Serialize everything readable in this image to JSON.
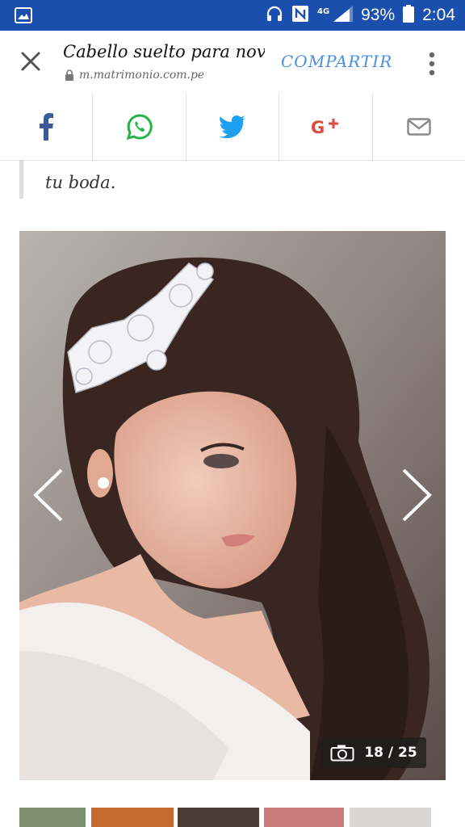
{
  "statusbar": {
    "battery": "93%",
    "time": "2:04",
    "icons": [
      "image-icon",
      "headphones-icon",
      "nfc-icon",
      "signal-4g-icon",
      "battery-icon"
    ]
  },
  "toolbar": {
    "title": "Cabello suelto para novi...",
    "url": "m.matrimonio.com.pe",
    "share_label": "COMPARTIR"
  },
  "share_buttons": [
    {
      "name": "facebook",
      "color": "#3b5998"
    },
    {
      "name": "whatsapp",
      "color": "#25b448"
    },
    {
      "name": "twitter",
      "color": "#1da1f2"
    },
    {
      "name": "google-plus",
      "color": "#dd4b39"
    },
    {
      "name": "email",
      "color": "#888888"
    }
  ],
  "article": {
    "quote_tail": "tu boda."
  },
  "gallery": {
    "counter": "18 / 25"
  }
}
